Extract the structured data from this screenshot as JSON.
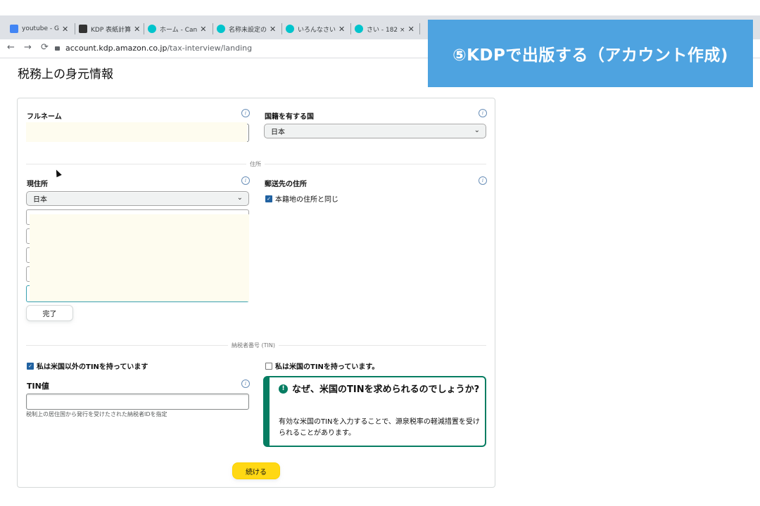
{
  "browser": {
    "tabs": [
      {
        "label": "youtube - G",
        "icon": "docs-icon",
        "color": "#4285f4"
      },
      {
        "label": "KDP 表紙計算",
        "icon": "kdp-icon",
        "color": "#333333"
      },
      {
        "label": "ホーム - Can",
        "icon": "canva-icon",
        "color": "#00c4cc"
      },
      {
        "label": "名称未設定の",
        "icon": "canva-icon",
        "color": "#00c4cc"
      },
      {
        "label": "いろんなさい",
        "icon": "canva-icon",
        "color": "#00c4cc"
      },
      {
        "label": "さい - 182 ×",
        "icon": "canva-icon",
        "color": "#00c4cc"
      }
    ],
    "url_host": "account.kdp.amazon.co.jp",
    "url_path": "/tax-interview/landing"
  },
  "overlay": {
    "caption": "⑤KDPで出版する（アカウント作成)"
  },
  "page": {
    "title": "税務上の身元情報"
  },
  "form": {
    "full_name_label": "フルネーム",
    "nationality_label": "国籍を有する国",
    "nationality_value": "日本",
    "address_section": "住所",
    "current_address_label": "現住所",
    "current_address_country": "日本",
    "mailing_address_label": "郵送先の住所",
    "same_as_address_label": "本籍地の住所と同じ",
    "done_button": "完了",
    "tin_section": "納税者番号 (TIN)",
    "non_us_tin_label": "私は米国以外のTINを持っています",
    "us_tin_label": "私は米国のTINを持っています。",
    "tin_value_label": "TIN値",
    "tin_hint": "税制上の居住国から発行を受けたされた納税者IDを指定",
    "info_box_title": "なぜ、米国のTINを求められるのでしょうか?",
    "info_box_body": "有効な米国のTINを入力することで、源泉税率の軽減措置を受けられることがあります。",
    "continue_button": "続ける"
  },
  "colors": {
    "accent": "#067d62",
    "button_primary": "#ffd814",
    "overlay_bg": "#4ea3e0",
    "checkbox": "#2162a1"
  }
}
